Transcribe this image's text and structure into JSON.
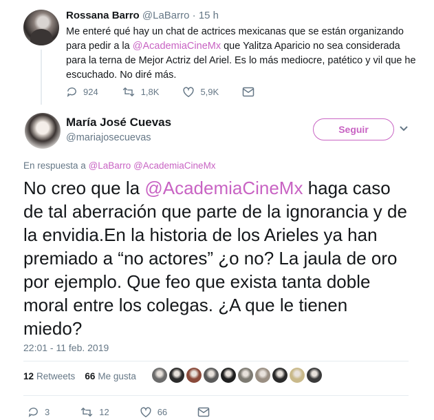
{
  "parent_tweet": {
    "name": "Rossana Barro",
    "handle": "@LaBarro",
    "separator": " · ",
    "time": "15 h",
    "body_before": "Me enteré qué hay un chat de actrices mexicanas que se están organizando para pedir a la ",
    "body_mention": "@AcademiaCineMx",
    "body_after": " que Yalitza Aparicio no sea considerada para la terna de Mejor Actriz del Ariel. Es lo más mediocre, patético y vil que he escuchado. No diré más.",
    "replies": "924",
    "retweets": "1,8K",
    "likes": "5,9K"
  },
  "main_tweet": {
    "name": "María José Cuevas",
    "handle": "@mariajosecuevas",
    "follow_label": "Seguir",
    "reply_prefix": "En respuesta a ",
    "reply_mention_1": "@LaBarro",
    "reply_mention_2": "@AcademiaCineMx",
    "body_before": "No creo que la ",
    "body_mention": "@AcademiaCineMx",
    "body_after": " haga caso de tal aberración que parte de la ignorancia y de la envidia.En la historia de los Arieles ya han premiado a “no actores” ¿o no? La jaula de oro por ejemplo. Que feo que exista tanta doble moral entre los colegas. ¿A que le tienen miedo?",
    "timestamp": "22:01 - 11 feb. 2019",
    "retweets_count": "12",
    "retweets_label": "Retweets",
    "likes_count": "66",
    "likes_label": "Me gusta",
    "replies": "3",
    "retweets": "12",
    "likes": "66"
  },
  "liker_avatars": [
    "#6b6b6b",
    "#2b2b2b",
    "#8a4a3a",
    "#5a5a5a",
    "#1f1f1f",
    "#7d7a72",
    "#9a8f83",
    "#2a2a2a",
    "#c9b98a",
    "#3a3a3a"
  ],
  "colors": {
    "accent": "#c863c3",
    "muted": "#657786",
    "text": "#14171a"
  },
  "icons": [
    "reply-icon",
    "retweet-icon",
    "heart-icon",
    "message-icon",
    "chevron-down-icon"
  ]
}
